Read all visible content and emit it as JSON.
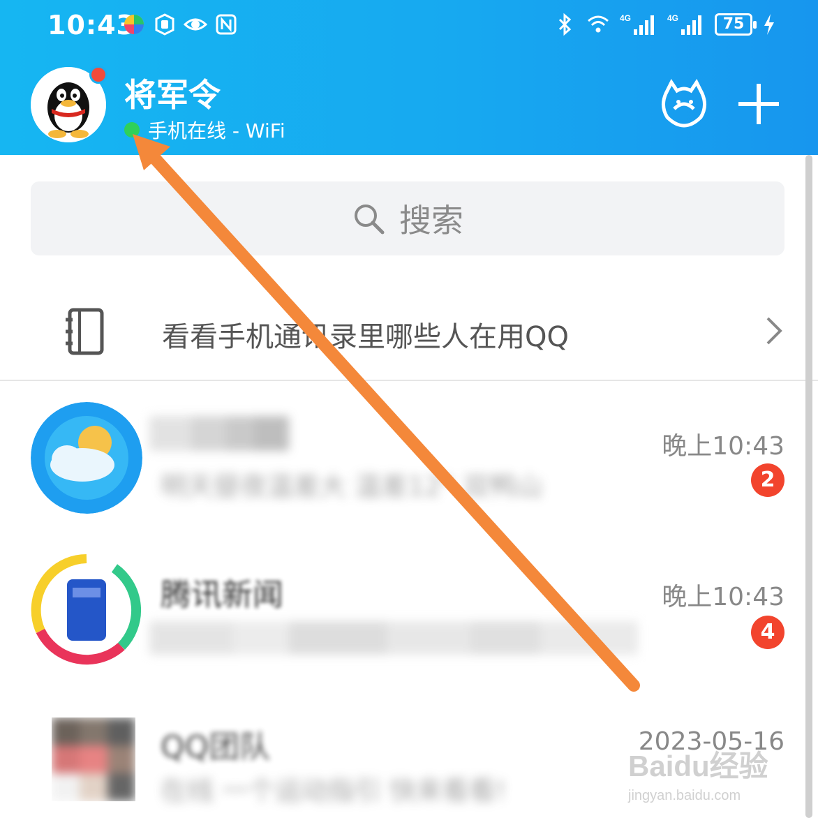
{
  "status_bar": {
    "time": "10:43",
    "icons_left": [
      "multicolor-app-icon",
      "hand-shield-icon",
      "eye-icon",
      "nfc-icon"
    ],
    "icons_right": [
      "bluetooth-icon",
      "wifi-icon",
      "signal-4g-icon",
      "signal-4g-icon-2",
      "battery-icon",
      "charging-icon"
    ],
    "network_1": "4G",
    "network_2": "4G",
    "battery": "75"
  },
  "header": {
    "name": "将军令",
    "status_text": "手机在线 - WiFi",
    "online_color": "#2fd05a",
    "gradient_start": "#16b6f2",
    "gradient_end": "#1796ee"
  },
  "search": {
    "placeholder": "搜索"
  },
  "contacts_banner": {
    "text": "看看手机通讯录里哪些人在用QQ"
  },
  "chats": [
    {
      "name": "",
      "time": "晚上10:43",
      "preview": "明天昼夜温差大 温差12° 双鸭山",
      "unread": "2"
    },
    {
      "name": "腾讯新闻",
      "time": "晚上10:43",
      "preview": "",
      "unread": "4"
    },
    {
      "name": "QQ团队",
      "time": "2023-05-16",
      "preview": "在线 一个运动指引 快来看看!",
      "unread": ""
    }
  ],
  "watermark": {
    "main": "Baidu经验",
    "sub": "jingyan.baidu.com"
  },
  "colors": {
    "badge": "#f2442d",
    "arrow": "#f4883a",
    "accent": "#17aef1"
  }
}
